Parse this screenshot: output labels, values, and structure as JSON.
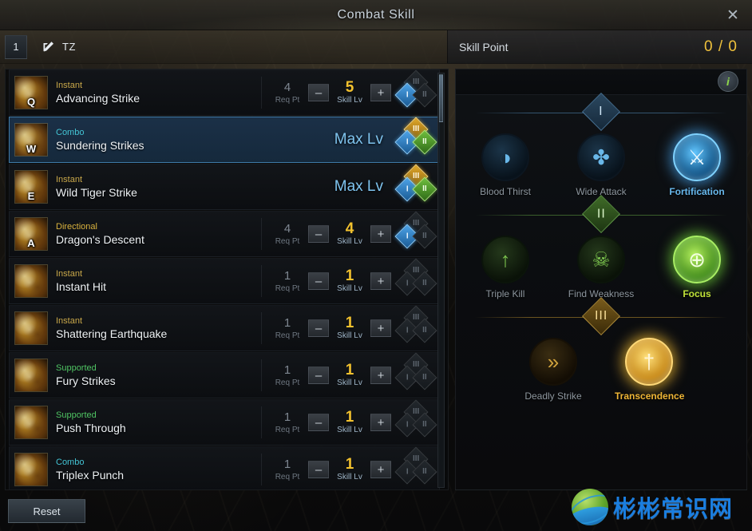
{
  "window": {
    "title": "Combat Skill",
    "close_icon": "close-icon"
  },
  "subheader": {
    "tab_number": "1",
    "pen_icon": "pen-edit-icon",
    "character_label": "TZ",
    "skill_point_label": "Skill Point",
    "skill_point_value": "0 / 0"
  },
  "colors": {
    "gold": "#f2c12e",
    "blue_accent": "#7fc4ef",
    "combo_cyan": "#43c4d4",
    "supported_green": "#4fc463",
    "instant_gold": "#c9a84a",
    "tier1": "#69b7e8",
    "tier2": "#7cc44e",
    "tier3": "#cfa23c"
  },
  "skill_list": {
    "req_pt_label": "Req Pt",
    "skill_lv_label": "Skill Lv",
    "max_lv_label": "Max Lv",
    "minus_label": "–",
    "plus_label": "+",
    "tier_labels": {
      "t1": "I",
      "t2": "II",
      "t3": "III"
    },
    "rows": [
      {
        "key": "Q",
        "category": "Instant",
        "cat_class": "cat-instant",
        "name": "Advancing Strike",
        "selected": false,
        "maxed": false,
        "req_pt": "4",
        "skill_lv": "5",
        "badges": {
          "t1": "on1",
          "t2": "off",
          "t3": "off"
        }
      },
      {
        "key": "W",
        "category": "Combo",
        "cat_class": "cat-combo",
        "name": "Sundering Strikes",
        "selected": true,
        "maxed": true,
        "req_pt": "",
        "skill_lv": "",
        "badges": {
          "t1": "on1",
          "t2": "on2",
          "t3": "on3"
        }
      },
      {
        "key": "E",
        "category": "Instant",
        "cat_class": "cat-instant",
        "name": "Wild Tiger Strike",
        "selected": false,
        "maxed": true,
        "req_pt": "",
        "skill_lv": "",
        "badges": {
          "t1": "on1",
          "t2": "on2",
          "t3": "on3"
        }
      },
      {
        "key": "A",
        "category": "Directional",
        "cat_class": "cat-directional",
        "name": "Dragon's Descent",
        "selected": false,
        "maxed": false,
        "req_pt": "4",
        "skill_lv": "4",
        "badges": {
          "t1": "on1",
          "t2": "off",
          "t3": "off"
        }
      },
      {
        "key": "",
        "category": "Instant",
        "cat_class": "cat-instant",
        "name": "Instant Hit",
        "selected": false,
        "maxed": false,
        "req_pt": "1",
        "skill_lv": "1",
        "badges": {
          "t1": "off",
          "t2": "off",
          "t3": "off"
        }
      },
      {
        "key": "",
        "category": "Instant",
        "cat_class": "cat-instant",
        "name": "Shattering Earthquake",
        "selected": false,
        "maxed": false,
        "req_pt": "1",
        "skill_lv": "1",
        "badges": {
          "t1": "off",
          "t2": "off",
          "t3": "off"
        }
      },
      {
        "key": "",
        "category": "Supported",
        "cat_class": "cat-supported",
        "name": "Fury Strikes",
        "selected": false,
        "maxed": false,
        "req_pt": "1",
        "skill_lv": "1",
        "badges": {
          "t1": "off",
          "t2": "off",
          "t3": "off"
        }
      },
      {
        "key": "",
        "category": "Supported",
        "cat_class": "cat-supported",
        "name": "Push Through",
        "selected": false,
        "maxed": false,
        "req_pt": "1",
        "skill_lv": "1",
        "badges": {
          "t1": "off",
          "t2": "off",
          "t3": "off"
        }
      },
      {
        "key": "",
        "category": "Combo",
        "cat_class": "cat-combo",
        "name": "Triplex Punch",
        "selected": false,
        "maxed": false,
        "req_pt": "1",
        "skill_lv": "1",
        "badges": {
          "t1": "off",
          "t2": "off",
          "t3": "off"
        }
      }
    ]
  },
  "tree_panel": {
    "info_icon": "info-icon",
    "info_label": "i",
    "tiers": [
      {
        "tier_label": "I",
        "tier_class": "tier1",
        "nodes": [
          {
            "label": "Blood Thirst",
            "icon": "blood-thirst-icon",
            "glyph": "◑",
            "active": false
          },
          {
            "label": "Wide Attack",
            "icon": "wide-attack-icon",
            "glyph": "✤",
            "active": false
          },
          {
            "label": "Fortification",
            "icon": "fortification-icon",
            "glyph": "⚔",
            "active": true
          }
        ]
      },
      {
        "tier_label": "II",
        "tier_class": "tier2",
        "nodes": [
          {
            "label": "Triple Kill",
            "icon": "triple-kill-icon",
            "glyph": "↑",
            "active": false
          },
          {
            "label": "Find Weakness",
            "icon": "find-weakness-icon",
            "glyph": "☠",
            "active": false
          },
          {
            "label": "Focus",
            "icon": "focus-icon",
            "glyph": "⊕",
            "active": true
          }
        ]
      },
      {
        "tier_label": "III",
        "tier_class": "tier3",
        "nodes": [
          {
            "label": "Deadly Strike",
            "icon": "deadly-strike-icon",
            "glyph": "»",
            "active": false
          },
          {
            "label": "Transcendence",
            "icon": "transcendence-icon",
            "glyph": "†",
            "active": true
          }
        ]
      }
    ]
  },
  "footer": {
    "reset_label": "Reset"
  },
  "watermark": {
    "text": "彬彬常识网",
    "logo_icon": "globe-logo-icon"
  }
}
